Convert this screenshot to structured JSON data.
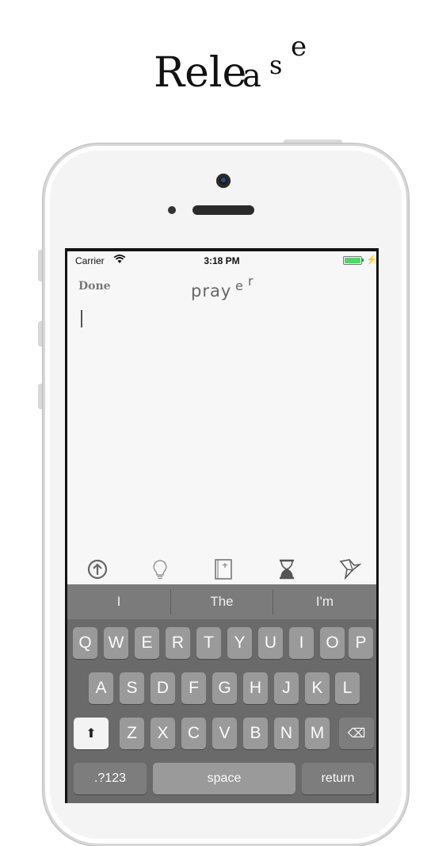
{
  "headline": {
    "main": "Rele",
    "a": "a",
    "s": "s",
    "e": "e"
  },
  "status_bar": {
    "carrier": "Carrier",
    "time": "3:18 PM",
    "battery_color": "#4cd964",
    "charging_glyph": "⚡"
  },
  "nav": {
    "done_label": "Done",
    "title_pray": "pray",
    "title_e": "e",
    "title_r": "r"
  },
  "toolbar": {
    "icons": [
      "upload-arrow-icon",
      "lightbulb-icon",
      "book-icon",
      "hourglass-icon",
      "origami-bird-icon"
    ]
  },
  "keyboard": {
    "suggestions": [
      "I",
      "The",
      "I'm"
    ],
    "row1": [
      "Q",
      "W",
      "E",
      "R",
      "T",
      "Y",
      "U",
      "I",
      "O",
      "P"
    ],
    "row2": [
      "A",
      "S",
      "D",
      "F",
      "G",
      "H",
      "J",
      "K",
      "L"
    ],
    "row3": [
      "Z",
      "X",
      "C",
      "V",
      "B",
      "N",
      "M"
    ],
    "shift_glyph": "⬆",
    "delete_glyph": "⌫",
    "numbers_label": ".?123",
    "space_label": "space",
    "return_label": "return"
  }
}
